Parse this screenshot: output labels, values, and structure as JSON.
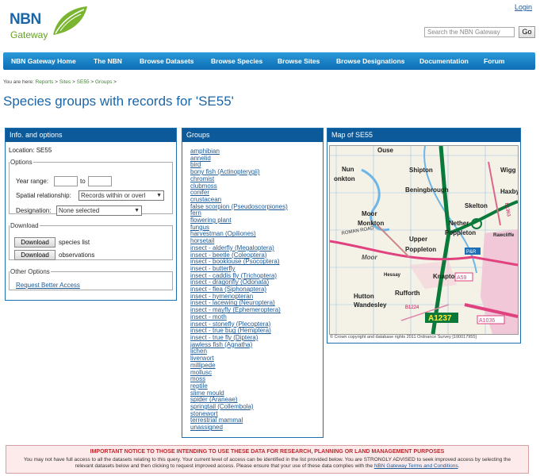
{
  "header": {
    "logo_line1": "NBN",
    "logo_line2": "Gateway",
    "login": "Login",
    "search_placeholder": "Search the NBN Gateway",
    "go": "Go"
  },
  "nav": [
    "NBN Gateway Home",
    "The NBN",
    "Browse Datasets",
    "Browse Species",
    "Browse Sites",
    "Browse Designations",
    "Documentation",
    "Forum"
  ],
  "breadcrumb": {
    "prefix": "You are here:",
    "items": [
      "Reports",
      "Sites",
      "SE55",
      "Groups"
    ]
  },
  "page_title": "Species groups with records for 'SE55'",
  "info": {
    "heading": "Info. and options",
    "location": "Location: SE55",
    "options_legend": "Options",
    "year_range_label": "Year range:",
    "to_label": "to",
    "spatial_label": "Spatial relationship:",
    "spatial_value": "Records within or overl",
    "designation_label": "Designation:",
    "designation_value": "None selected",
    "download_legend": "Download",
    "download_button": "Download",
    "species_list": "species list",
    "observations": "observations",
    "other_legend": "Other Options",
    "request_link": "Request Better Access"
  },
  "groups": {
    "heading": "Groups",
    "items": [
      "amphibian",
      "annelid",
      "bird",
      "bony fish (Actinopterygii)",
      "chromist",
      "clubmoss",
      "conifer",
      "crustacean",
      "false scorpion (Pseudoscorpiones)",
      "fern",
      "flowering plant",
      "fungus",
      "harvestman (Opiliones)",
      "horsetail",
      "insect - alderfly (Megaloptera)",
      "insect - beetle (Coleoptera)",
      "insect - booklouse (Psocoptera)",
      "insect - butterfly",
      "insect - caddis fly (Trichoptera)",
      "insect - dragonfly (Odonata)",
      "insect - flea (Siphonaptera)",
      "insect - hymenopteran",
      "insect - lacewing (Neuroptera)",
      "insect - mayfly (Ephemeroptera)",
      "insect - moth",
      "insect - stonefly (Plecoptera)",
      "insect - true bug (Hemiptera)",
      "insect - true fly (Diptera)",
      "jawless fish (Agnatha)",
      "lichen",
      "liverwort",
      "millipede",
      "mollusc",
      "moss",
      "reptile",
      "slime mould",
      "spider (Araneae)",
      "springtail (Collembola)",
      "stonewort",
      "terrestrial mammal",
      "unassigned"
    ]
  },
  "map": {
    "heading": "Map of SE55",
    "places": [
      "Ouse",
      "Nun",
      "Shipton",
      "Wigg",
      "onkton",
      "Beningbrough",
      "Haxby",
      "Skelton",
      "Moor",
      "Monkton",
      "Nether",
      "Poppleton",
      "Rawcliffe",
      "Upper",
      "Poppleton",
      "Moor",
      "Hessay",
      "Knapton",
      "Hutton",
      "Wandesley",
      "Rufforth"
    ],
    "roads": [
      "A1237",
      "A59",
      "A1036",
      "B1363",
      "B1224",
      "ROMAN ROAD",
      "P&R"
    ],
    "copyright": "© Crown copyright and database rights 2011 Ordnance Survey [100017955]"
  },
  "notice": {
    "heading": "IMPORTANT NOTICE TO THOSE INTENDING TO USE THESE DATA FOR RESEARCH, PLANNING OR LAND MANAGEMENT PURPOSES",
    "body": "You may not have full access to all the datasets relating to this query. Your current level of access can be identified in the list provided below. You are STRONGLY ADVISED to seek improved access by selecting the relevant datasets below and then clicking to request improved access. Please ensure that your use of these data complies with the",
    "link": "NBN Gateway Terms and Conditions",
    "end": "."
  },
  "colors": {
    "nav": "#1b86cc",
    "panel_head": "#0c5a9a",
    "title": "#1c66a8",
    "logo_green": "#6aa12a",
    "notice_red": "#c0282e"
  }
}
